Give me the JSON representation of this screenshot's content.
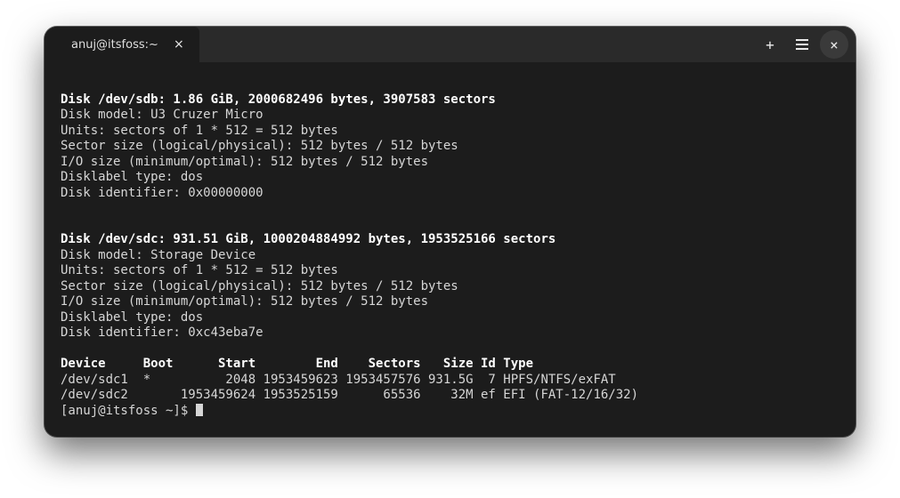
{
  "titlebar": {
    "tab_title": "anuj@itsfoss:~",
    "close_glyph": "×",
    "new_tab_glyph": "+",
    "window_close_glyph": "×"
  },
  "disks": [
    {
      "header": "Disk /dev/sdb: 1.86 GiB, 2000682496 bytes, 3907583 sectors",
      "model": "Disk model: U3 Cruzer Micro ",
      "units": "Units: sectors of 1 * 512 = 512 bytes",
      "sector_size": "Sector size (logical/physical): 512 bytes / 512 bytes",
      "io_size": "I/O size (minimum/optimal): 512 bytes / 512 bytes",
      "label": "Disklabel type: dos",
      "identifier": "Disk identifier: 0x00000000"
    },
    {
      "header": "Disk /dev/sdc: 931.51 GiB, 1000204884992 bytes, 1953525166 sectors",
      "model": "Disk model: Storage Device  ",
      "units": "Units: sectors of 1 * 512 = 512 bytes",
      "sector_size": "Sector size (logical/physical): 512 bytes / 512 bytes",
      "io_size": "I/O size (minimum/optimal): 512 bytes / 512 bytes",
      "label": "Disklabel type: dos",
      "identifier": "Disk identifier: 0xc43eba7e"
    }
  ],
  "partition_table": {
    "header": "Device     Boot      Start        End    Sectors   Size Id Type",
    "rows": [
      "/dev/sdc1  *          2048 1953459623 1953457576 931.5G  7 HPFS/NTFS/exFAT",
      "/dev/sdc2       1953459624 1953525159      65536    32M ef EFI (FAT-12/16/32)"
    ]
  },
  "prompt": "[anuj@itsfoss ~]$ "
}
